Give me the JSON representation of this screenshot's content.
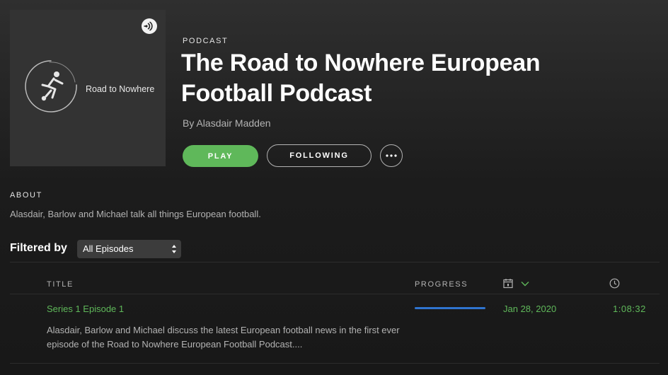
{
  "podcast": {
    "kind_label": "PODCAST",
    "title": "The Road to Nowhere European Football Podcast",
    "author": "By Alasdair Madden",
    "cover_text": "Road to Nowhere",
    "cover_icon": "anchor-podcast-icon"
  },
  "actions": {
    "play_label": "PLAY",
    "following_label": "FOLLOWING",
    "more_icon": "more-options-icon"
  },
  "about": {
    "heading": "ABOUT",
    "text": "Alasdair, Barlow and Michael talk all things European football."
  },
  "filter": {
    "label": "Filtered by",
    "selected": "All Episodes"
  },
  "table": {
    "headers": {
      "title": "TITLE",
      "progress": "PROGRESS",
      "date_icon": "calendar-icon",
      "sort_icon": "chevron-down-icon",
      "duration_icon": "clock-icon"
    },
    "episodes": [
      {
        "title": "Series 1 Episode 1",
        "description": "Alasdair, Barlow and Michael discuss the latest European football news in the first ever episode of the Road to Nowhere European Football Podcast....",
        "progress": 1.0,
        "date": "Jan 28, 2020",
        "duration": "1:08:32"
      }
    ]
  },
  "colors": {
    "accent_green": "#5fb85a",
    "progress_blue": "#2f74d0",
    "muted_text": "#b3b3b3"
  }
}
